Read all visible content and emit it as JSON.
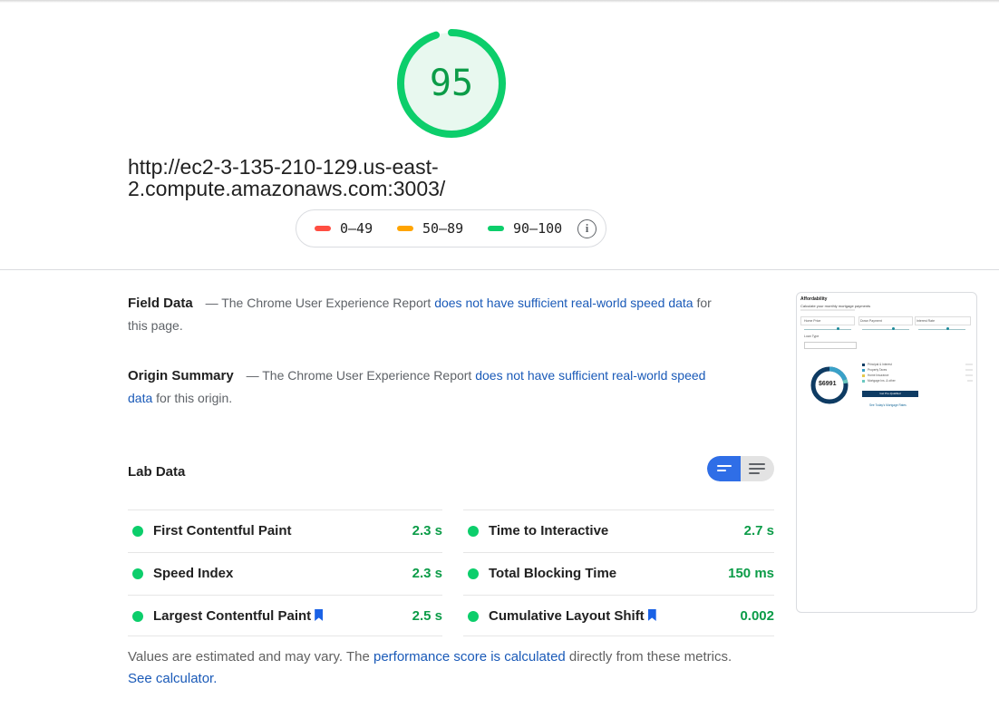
{
  "score": {
    "value": "95",
    "color": "#0cce6b"
  },
  "page_url": "http://ec2-3-135-210-129.us-east-2.compute.amazonaws.com:3003/",
  "legend": {
    "items": [
      {
        "label": "0–49",
        "color": "#ff4e42"
      },
      {
        "label": "50–89",
        "color": "#ffa400"
      },
      {
        "label": "90–100",
        "color": "#0cce6b"
      }
    ],
    "info_icon": "info-icon"
  },
  "field_data": {
    "heading": "Field Data",
    "text_before": "— The Chrome User Experience Report",
    "link": "does not have sufficient real-world speed data",
    "text_after": "for this page."
  },
  "origin_summary": {
    "heading": "Origin Summary",
    "text_before": "— The Chrome User Experience Report",
    "link": "does not have sufficient real-world speed data",
    "text_after": "for this origin."
  },
  "lab_data": {
    "title": "Lab Data",
    "metrics_left": [
      {
        "label": "First Contentful Paint",
        "value": "2.3 s",
        "bookmark": false
      },
      {
        "label": "Speed Index",
        "value": "2.3 s",
        "bookmark": false
      },
      {
        "label": "Largest Contentful Paint",
        "value": "2.5 s",
        "bookmark": true
      }
    ],
    "metrics_right": [
      {
        "label": "Time to Interactive",
        "value": "2.7 s",
        "bookmark": false
      },
      {
        "label": "Total Blocking Time",
        "value": "150 ms",
        "bookmark": false
      },
      {
        "label": "Cumulative Layout Shift",
        "value": "0.002",
        "bookmark": true
      }
    ]
  },
  "footer": {
    "text1": "Values are estimated and may vary. The",
    "link1": "performance score is calculated",
    "text2": "directly from these metrics.",
    "link2": "See calculator."
  },
  "thumbnail": {
    "title": "Affordability",
    "subtitle": "Calculate your monthly mortgage payments",
    "fields": [
      "Home Price",
      "Down Payment",
      "Interest Rate"
    ],
    "loan_type_label": "Loan Type",
    "donut_value": "$6991",
    "legend_items": [
      "Principal & Interest",
      "Property Taxes",
      "Home Insurance",
      "Mortgage Ins. & other"
    ],
    "button": "Get Pre-Qualified",
    "link": "See Today's Mortgage Rates",
    "accent": "#0e3b63",
    "teal": "#1b8a9a"
  }
}
